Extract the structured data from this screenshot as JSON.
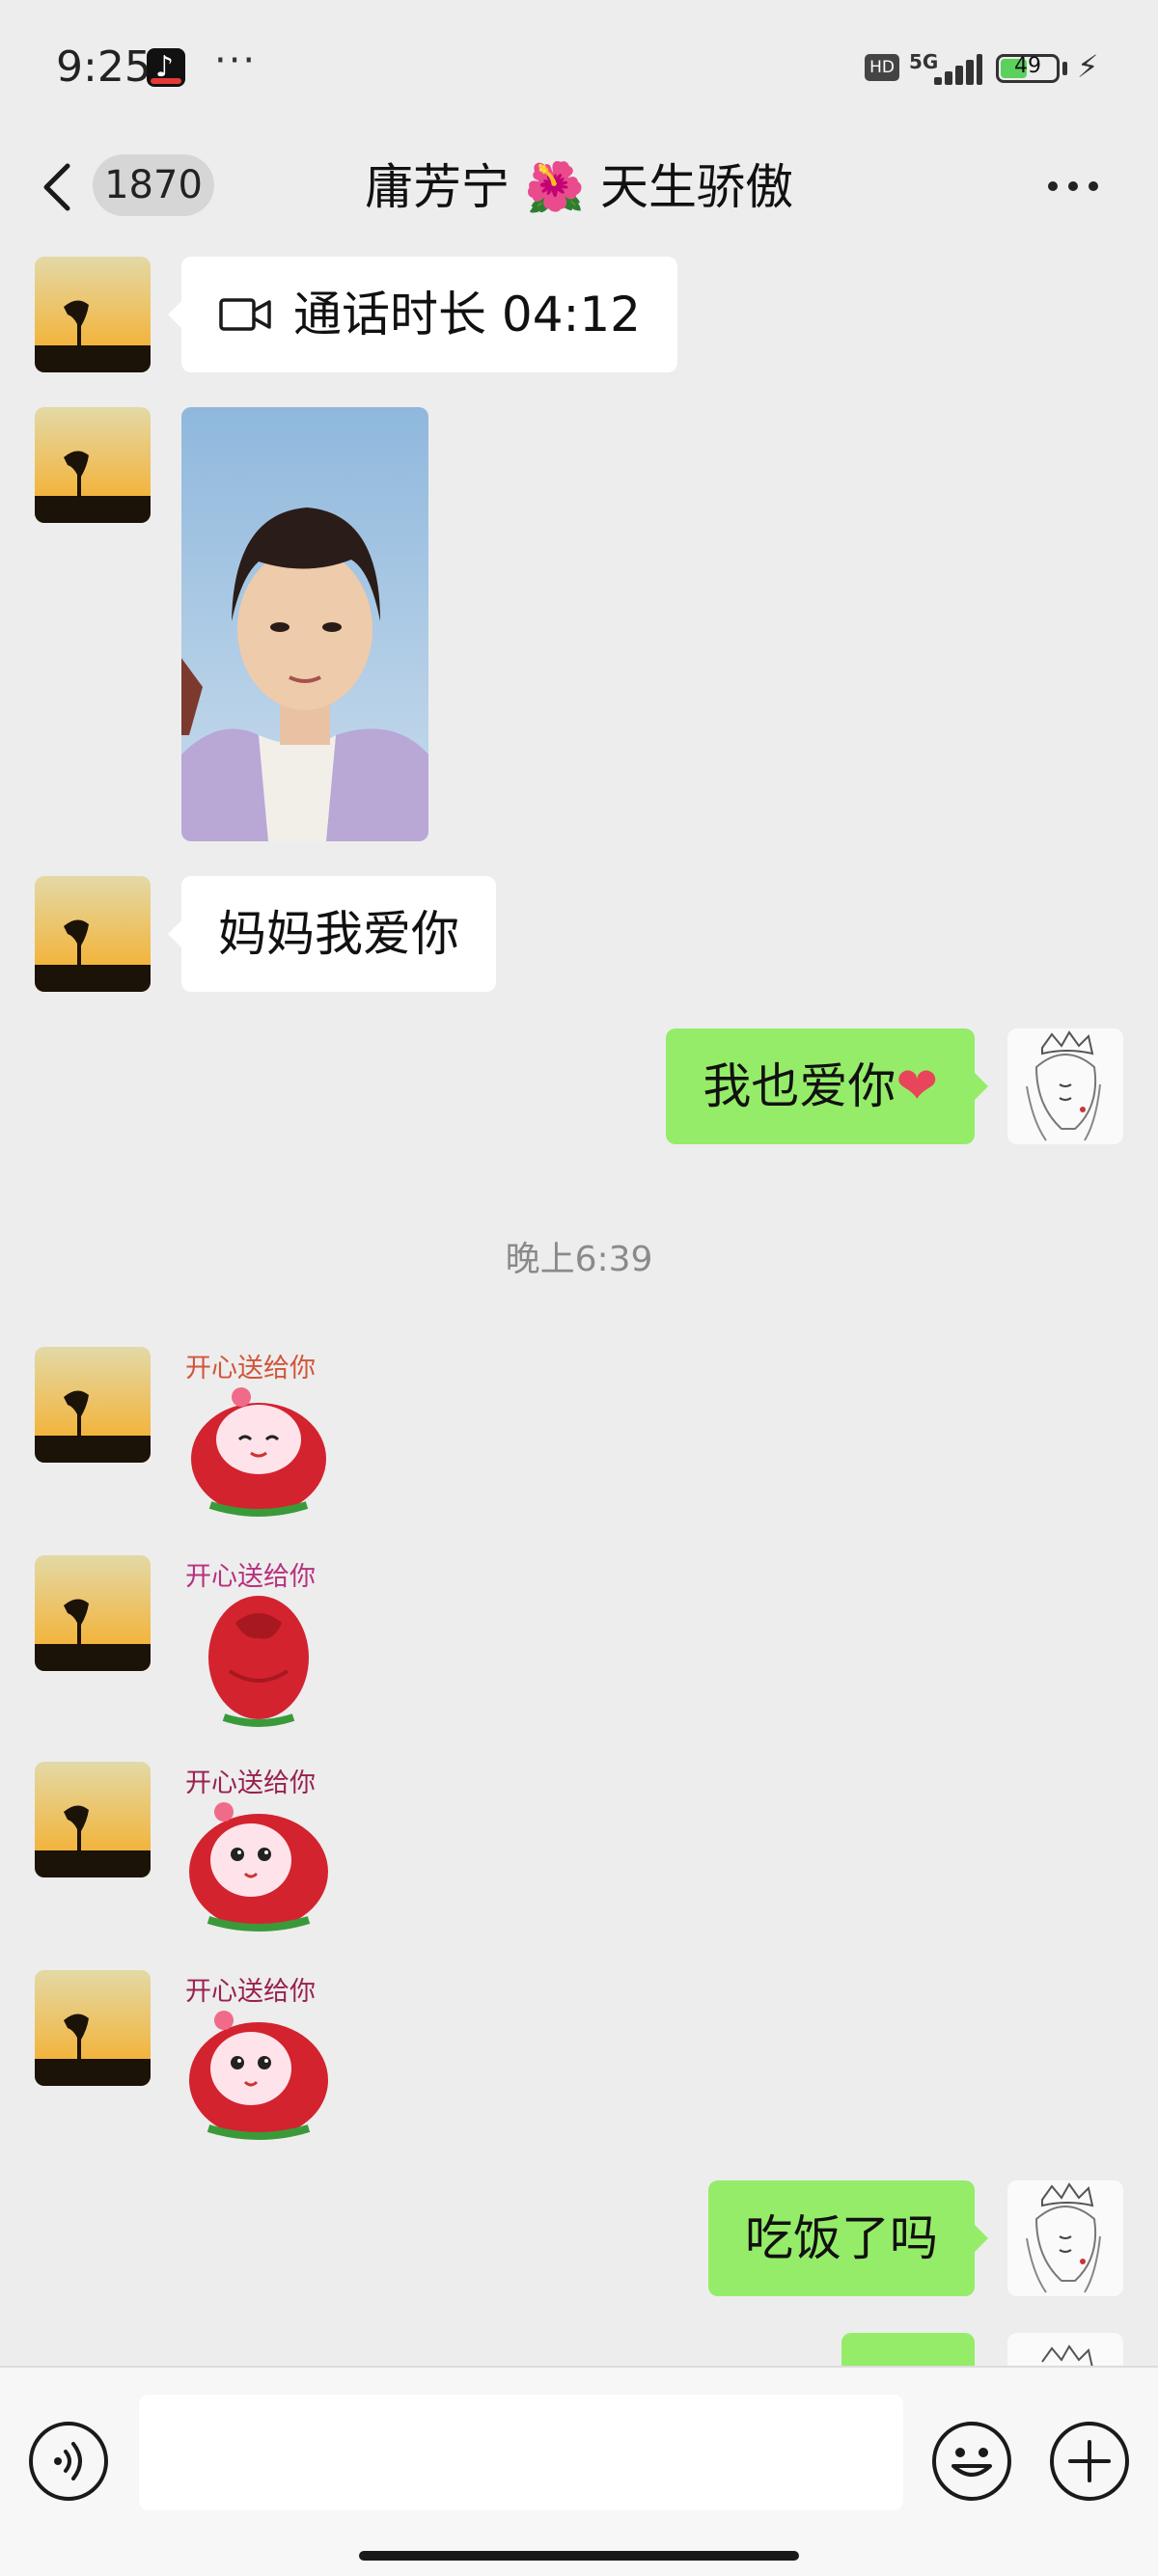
{
  "status_bar": {
    "time": "9:25",
    "dots": "···",
    "hd": "HD",
    "network": "5G",
    "battery": "49",
    "battery_level": 0.49
  },
  "header": {
    "unread_count": "1870",
    "title": "庸芳宁 🌺 天生骄傲"
  },
  "messages": [
    {
      "type": "call",
      "side": "left",
      "text": "通话时长 04:12"
    },
    {
      "type": "photo",
      "side": "left"
    },
    {
      "type": "text",
      "side": "left",
      "text": "妈妈我爱你"
    },
    {
      "type": "text",
      "side": "right",
      "text": "我也爱你",
      "emoji": "❤"
    },
    {
      "type": "timestamp",
      "text": "晚上6:39"
    },
    {
      "type": "sticker",
      "side": "left",
      "caption": "开心送给你"
    },
    {
      "type": "sticker",
      "side": "left",
      "caption": "开心送给你"
    },
    {
      "type": "sticker",
      "side": "left",
      "caption": "开心送给你"
    },
    {
      "type": "sticker",
      "side": "left",
      "caption": "开心送给你"
    },
    {
      "type": "text",
      "side": "right",
      "text": "吃饭了吗"
    }
  ],
  "input": {
    "value": "",
    "placeholder": ""
  },
  "icons": {
    "back": "chevron-left-icon",
    "more": "more-dots-icon",
    "voice": "voice-icon",
    "emoji": "emoji-icon",
    "plus": "plus-icon",
    "video_call": "video-call-icon"
  },
  "colors": {
    "background": "#ededed",
    "bubble_incoming": "#ffffff",
    "bubble_outgoing": "#95ec69",
    "timestamp": "#8a8a8a"
  }
}
